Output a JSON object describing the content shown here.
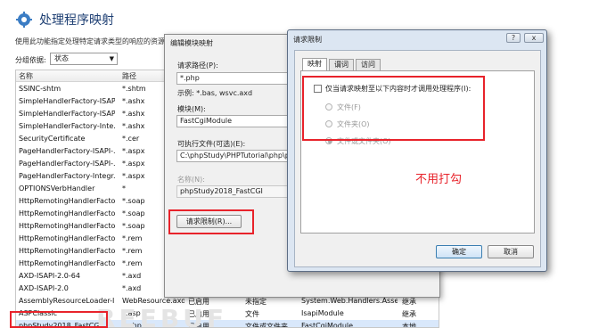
{
  "header": {
    "title": "处理程序映射",
    "description": "使用此功能指定处理特定请求类型的响应的资源，"
  },
  "toolbar": {
    "groupby_label": "分组依据:",
    "groupby_value": "状态"
  },
  "list": {
    "columns": [
      "名称",
      "路径",
      "",
      "",
      "",
      ""
    ],
    "rows": [
      {
        "name": "SSINC-shtm",
        "path": "*.shtm",
        "state": "",
        "type": "",
        "handler": "",
        "entry": ""
      },
      {
        "name": "SimpleHandlerFactory-ISAP...",
        "path": "*.ashx",
        "state": "",
        "type": "",
        "handler": "",
        "entry": ""
      },
      {
        "name": "SimpleHandlerFactory-ISAP...",
        "path": "*.ashx",
        "state": "",
        "type": "",
        "handler": "",
        "entry": ""
      },
      {
        "name": "SimpleHandlerFactory-Inte...",
        "path": "*.ashx",
        "state": "",
        "type": "",
        "handler": "",
        "entry": ""
      },
      {
        "name": "SecurityCertificate",
        "path": "*.cer",
        "state": "",
        "type": "",
        "handler": "",
        "entry": ""
      },
      {
        "name": "PageHandlerFactory-ISAPI-...",
        "path": "*.aspx",
        "state": "",
        "type": "",
        "handler": "",
        "entry": ""
      },
      {
        "name": "PageHandlerFactory-ISAPI-...",
        "path": "*.aspx",
        "state": "",
        "type": "",
        "handler": "",
        "entry": ""
      },
      {
        "name": "PageHandlerFactory-Integr...",
        "path": "*.aspx",
        "state": "",
        "type": "",
        "handler": "",
        "entry": ""
      },
      {
        "name": "OPTIONSVerbHandler",
        "path": "*",
        "state": "",
        "type": "",
        "handler": "",
        "entry": ""
      },
      {
        "name": "HttpRemotingHandlerFacto...",
        "path": "*.soap",
        "state": "",
        "type": "",
        "handler": "",
        "entry": ""
      },
      {
        "name": "HttpRemotingHandlerFacto...",
        "path": "*.soap",
        "state": "",
        "type": "",
        "handler": "",
        "entry": ""
      },
      {
        "name": "HttpRemotingHandlerFacto...",
        "path": "*.soap",
        "state": "",
        "type": "",
        "handler": "",
        "entry": ""
      },
      {
        "name": "HttpRemotingHandlerFacto...",
        "path": "*.rem",
        "state": "",
        "type": "",
        "handler": "",
        "entry": ""
      },
      {
        "name": "HttpRemotingHandlerFacto...",
        "path": "*.rem",
        "state": "",
        "type": "",
        "handler": "",
        "entry": ""
      },
      {
        "name": "HttpRemotingHandlerFacto...",
        "path": "*.rem",
        "state": "",
        "type": "",
        "handler": "",
        "entry": ""
      },
      {
        "name": "AXD-ISAPI-2.0-64",
        "path": "*.axd",
        "state": "",
        "type": "",
        "handler": "",
        "entry": ""
      },
      {
        "name": "AXD-ISAPI-2.0",
        "path": "*.axd",
        "state": "",
        "type": "",
        "handler": "",
        "entry": ""
      },
      {
        "name": "AssemblyResourceLoader-I...",
        "path": "WebResource.axd",
        "state": "已启用",
        "type": "未指定",
        "handler": "System.Web.Handlers.Asse...",
        "entry": "继承"
      },
      {
        "name": "ASPClassic",
        "path": "*.asp",
        "state": "已启用",
        "type": "文件",
        "handler": "IsapiModule",
        "entry": "继承"
      },
      {
        "name": "phpStudy2018_FastCGI",
        "path": "*.php",
        "state": "已启用",
        "type": "文件或文件夹",
        "handler": "FastCgiModule",
        "entry": "本地"
      }
    ],
    "watermark": "REEBUF"
  },
  "edit_dialog": {
    "title": "编辑模块映射",
    "path_label": "请求路径(P):",
    "path_value": "*.php",
    "example": "示例: *.bas, wsvc.axd",
    "module_label": "模块(M):",
    "module_value": "FastCgiModule",
    "exe_label": "可执行文件(可选)(E):",
    "exe_value": "C:\\phpStudy\\PHPTutorial\\php\\php",
    "name_label": "名称(N):",
    "name_value": "phpStudy2018_FastCGI",
    "restrict_button": "请求限制(R)..."
  },
  "request_dialog": {
    "title": "请求限制",
    "help_btn": "?",
    "close_btn": "x",
    "tabs": [
      "映射",
      "谓词",
      "访问"
    ],
    "checkbox_label": "仅当请求映射至以下内容时才调用处理程序(I):",
    "options": [
      "文件(F)",
      "文件夹(O)",
      "文件或文件夹(O)"
    ],
    "note": "不用打勾",
    "ok": "确定",
    "cancel": "取消"
  },
  "colors": {
    "highlight": "#e8232b",
    "title_blue": "#1e3f73"
  }
}
